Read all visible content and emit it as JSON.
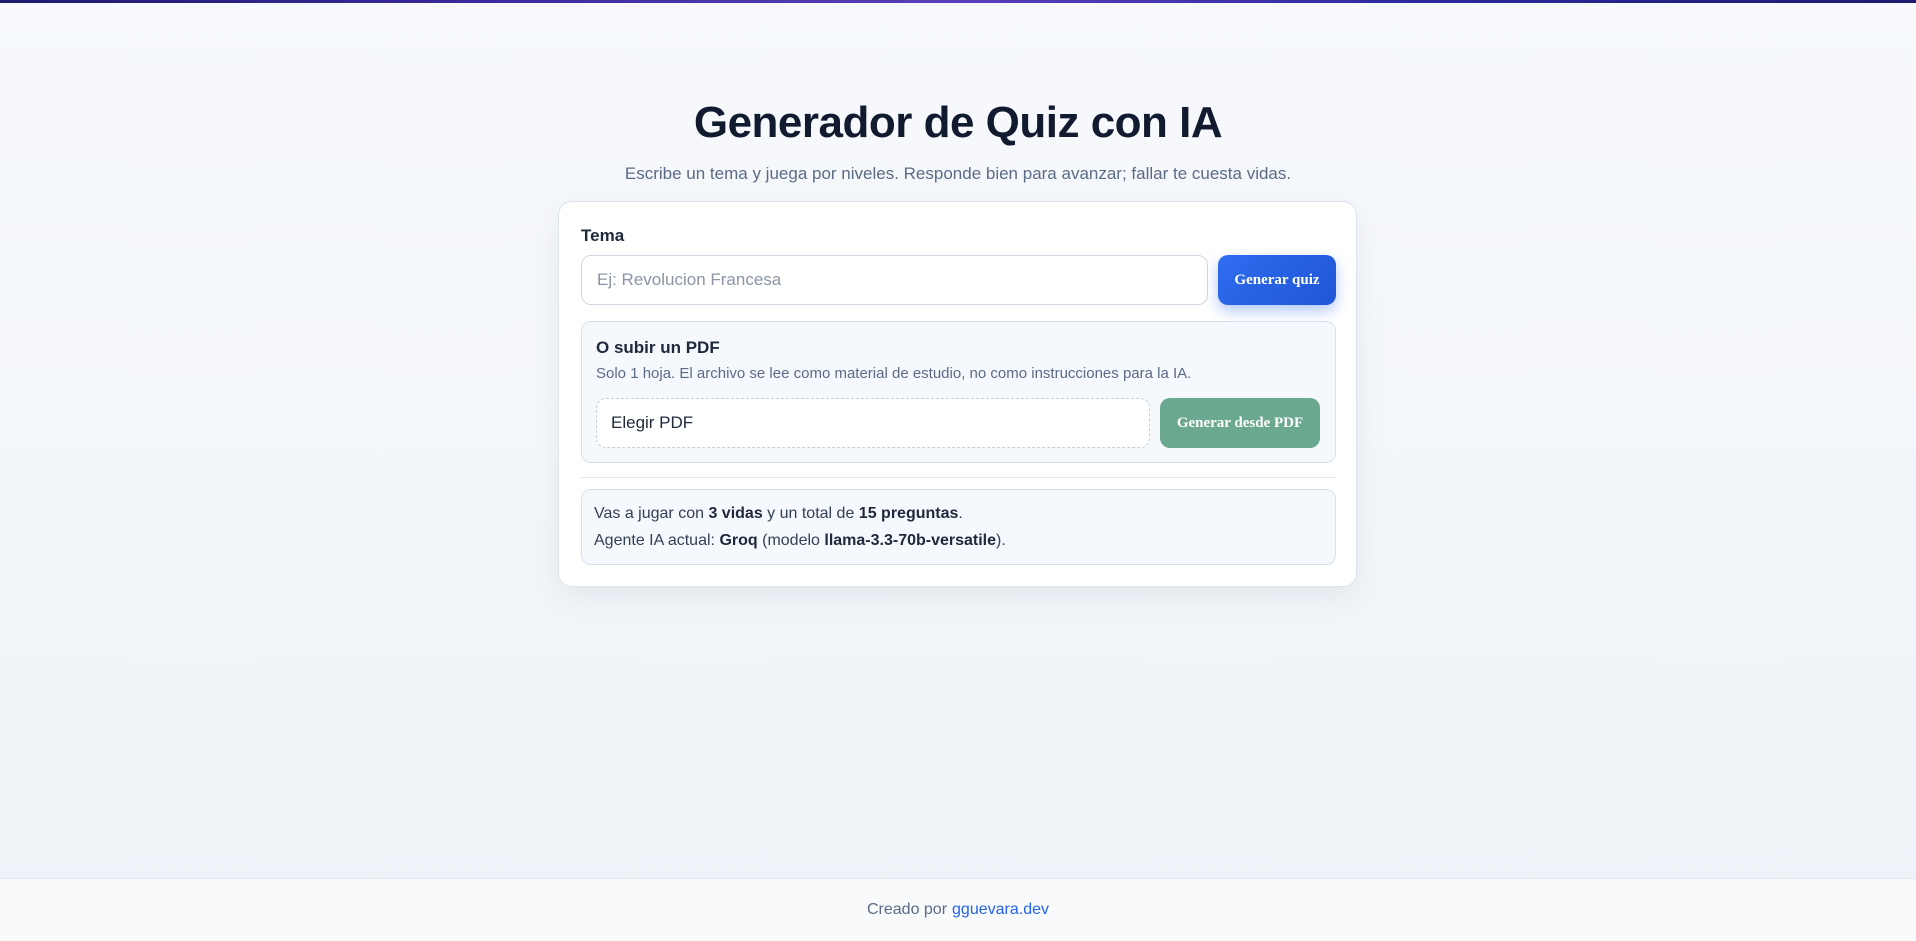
{
  "page": {
    "title": "Generador de Quiz con IA",
    "subtitle": "Escribe un tema y juega por niveles. Responde bien para avanzar; fallar te cuesta vidas."
  },
  "topic": {
    "label": "Tema",
    "placeholder": "Ej: Revolucion Francesa",
    "value": "",
    "button": "Generar quiz"
  },
  "pdf": {
    "title": "O subir un PDF",
    "description": "Solo 1 hoja. El archivo se lee como material de estudio, no como instrucciones para la IA.",
    "file_label": "Elegir PDF",
    "button": "Generar desde PDF"
  },
  "info": {
    "line1_prefix": "Vas a jugar con",
    "lives": "3 vidas",
    "line1_middle": "y un total de",
    "questions": "15 preguntas",
    "line1_suffix": ".",
    "line2_prefix": "Agente IA actual:",
    "agent": "Groq",
    "line2_model_prefix": "(modelo",
    "model": "llama-3.3-70b-versatile",
    "line2_suffix": ")."
  },
  "footer": {
    "prefix": "Creado por",
    "link": "gguevara.dev"
  },
  "colors": {
    "primary": "#2563eb",
    "pdf_button": "#6aa88f",
    "title": "#111a2e"
  }
}
